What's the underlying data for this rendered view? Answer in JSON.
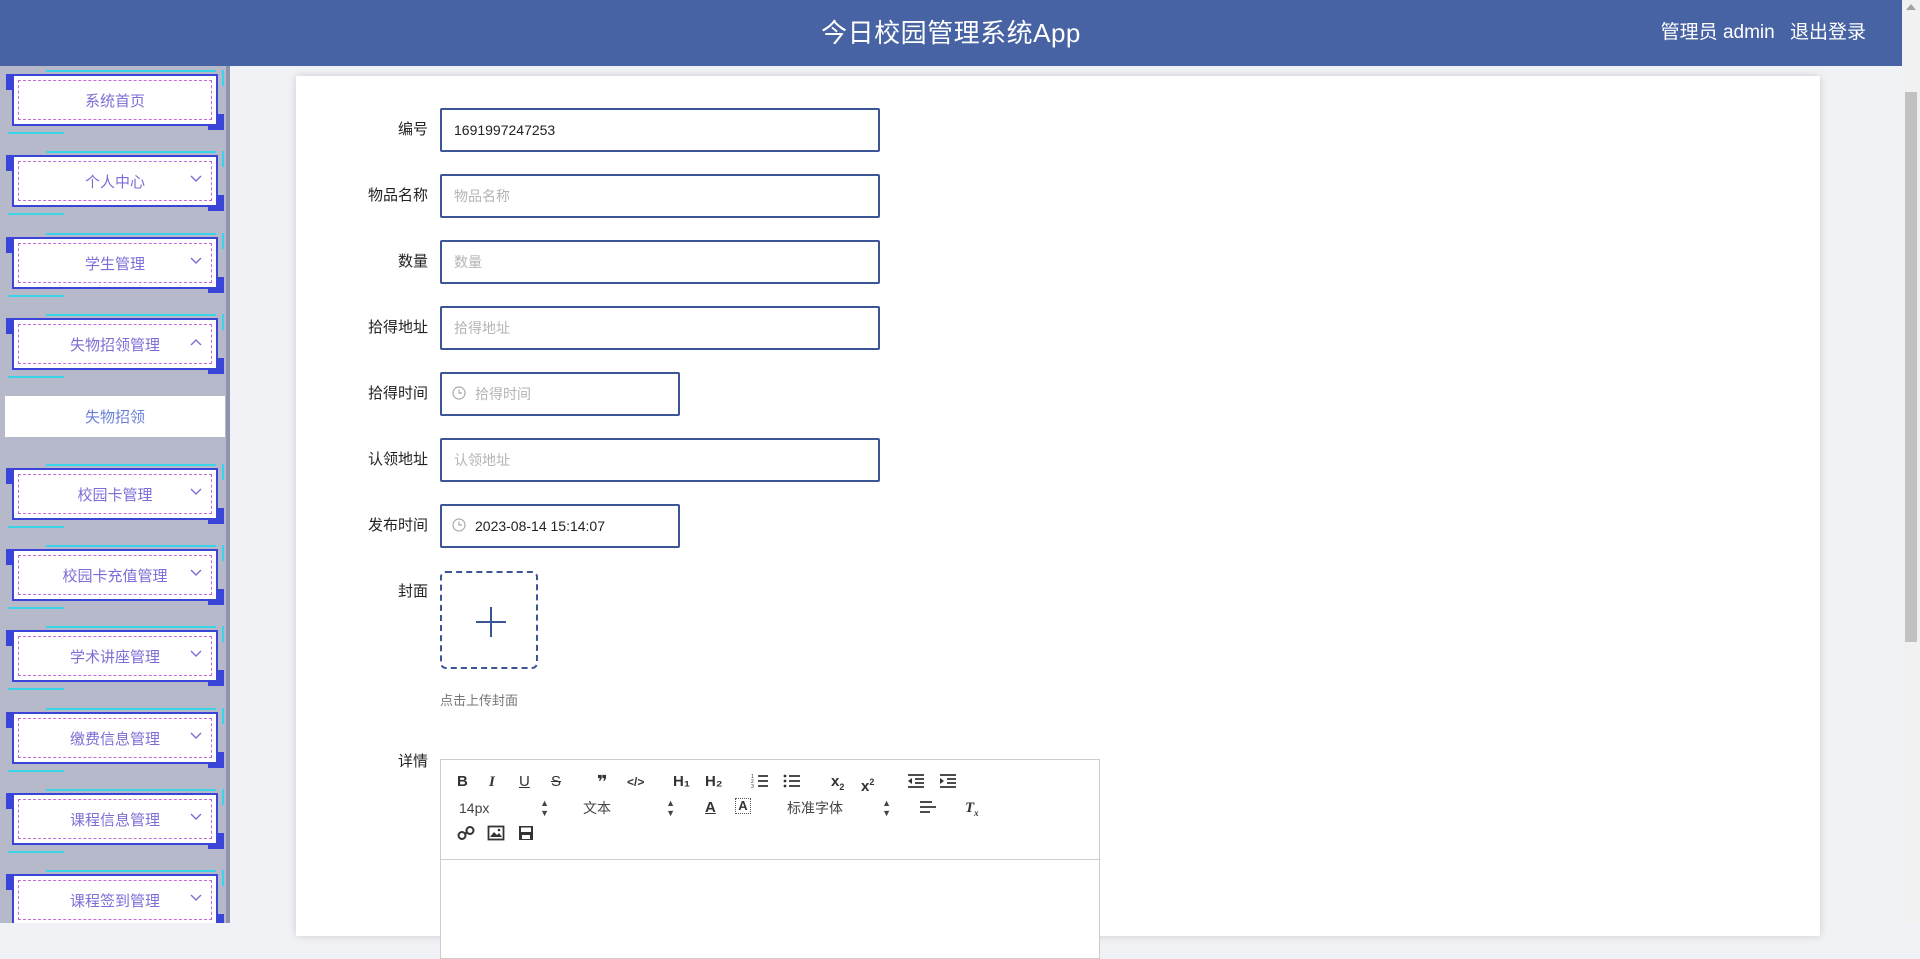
{
  "header": {
    "title": "今日校园管理系统App",
    "user_label": "管理员 admin",
    "logout_label": "退出登录"
  },
  "sidebar": {
    "items": [
      {
        "label": "系统首页",
        "has_chevron": false
      },
      {
        "label": "个人中心",
        "has_chevron": true,
        "chevron": "down"
      },
      {
        "label": "学生管理",
        "has_chevron": true,
        "chevron": "down"
      },
      {
        "label": "失物招领管理",
        "has_chevron": true,
        "chevron": "up"
      },
      {
        "label": "校园卡管理",
        "has_chevron": true,
        "chevron": "down"
      },
      {
        "label": "校园卡充值管理",
        "has_chevron": true,
        "chevron": "down"
      },
      {
        "label": "学术讲座管理",
        "has_chevron": true,
        "chevron": "down"
      },
      {
        "label": "缴费信息管理",
        "has_chevron": true,
        "chevron": "down"
      },
      {
        "label": "课程信息管理",
        "has_chevron": true,
        "chevron": "down"
      },
      {
        "label": "课程签到管理",
        "has_chevron": true,
        "chevron": "down"
      }
    ],
    "active_sub_item": "失物招领"
  },
  "form": {
    "bianhao": {
      "label": "编号",
      "value": "1691997247253",
      "placeholder": ""
    },
    "wupin": {
      "label": "物品名称",
      "value": "",
      "placeholder": "物品名称"
    },
    "shuliang": {
      "label": "数量",
      "value": "",
      "placeholder": "数量"
    },
    "shide_dizhi": {
      "label": "拾得地址",
      "value": "",
      "placeholder": "拾得地址"
    },
    "shide_shijian": {
      "label": "拾得时间",
      "value": "",
      "placeholder": "拾得时间"
    },
    "renling_dizhi": {
      "label": "认领地址",
      "value": "",
      "placeholder": "认领地址"
    },
    "fabu_shijian": {
      "label": "发布时间",
      "value": "2023-08-14 15:14:07",
      "placeholder": ""
    },
    "fengmian": {
      "label": "封面",
      "hint": "点击上传封面"
    },
    "xiangqing": {
      "label": "详情"
    }
  },
  "editor": {
    "font_size": "14px",
    "header_select": "文本",
    "font_family": "标准字体",
    "tool_h1": "H₁",
    "tool_h2": "H₂"
  },
  "icons": {
    "clock": "clock-icon",
    "plus": "plus-icon"
  },
  "colors": {
    "header_bg": "#4763a3",
    "sidebar_bg": "#b6b9c9",
    "accent_border": "#3c5594",
    "menu_text": "#7b6ed6"
  }
}
